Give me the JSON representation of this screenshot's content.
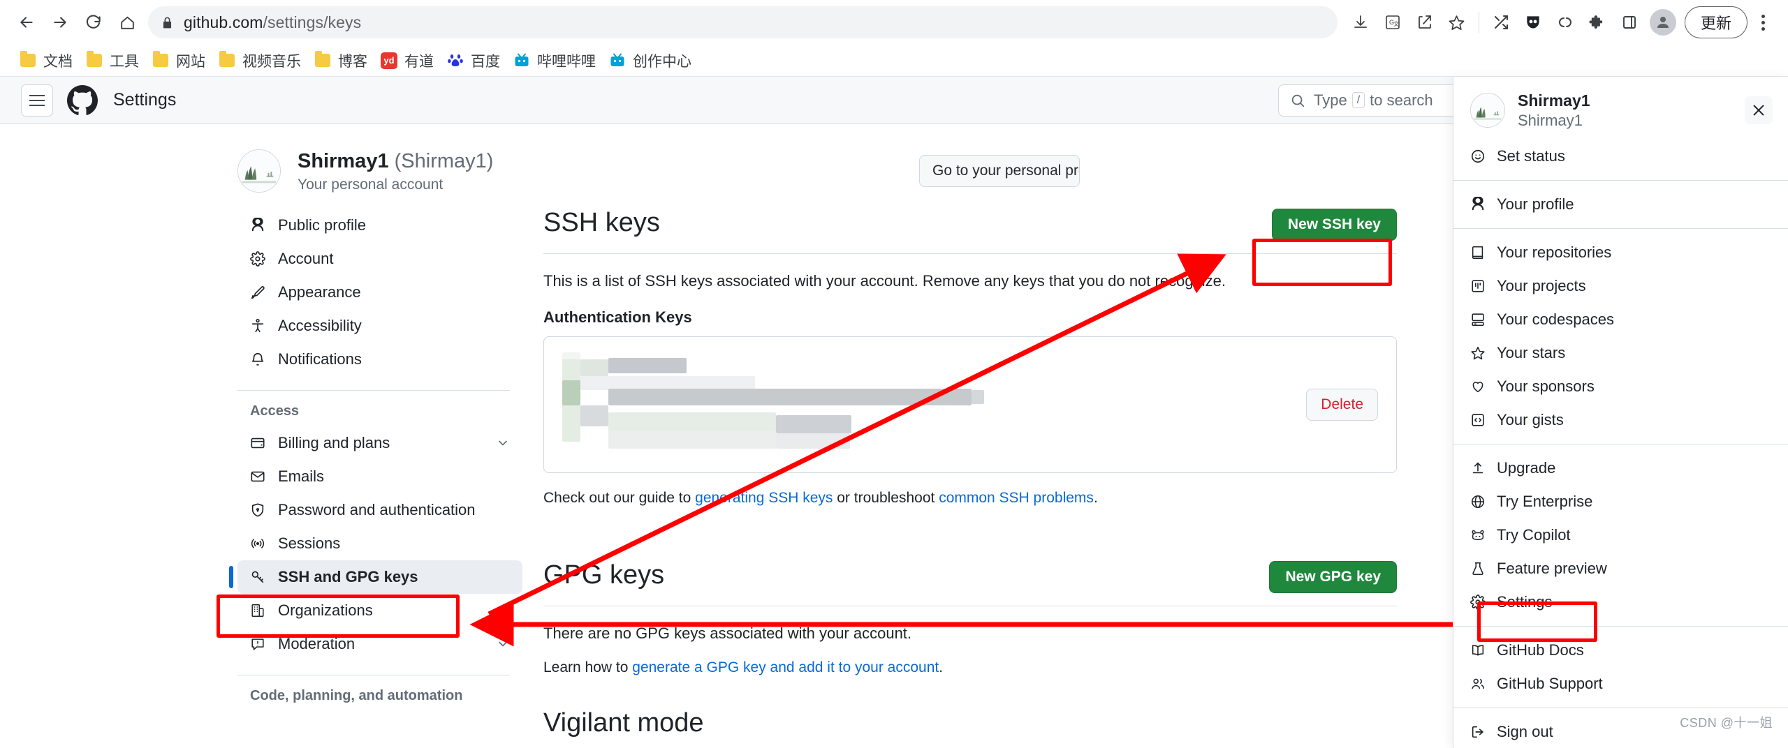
{
  "browser": {
    "url_domain": "github.com",
    "url_path": "/settings/keys",
    "nav": {
      "back": "back-arrow",
      "forward": "forward-arrow",
      "reload": "reload",
      "home": "home"
    },
    "lock_icon": "lock-icon",
    "right_icons": [
      "download-icon",
      "translate-icon",
      "share-icon",
      "star-icon",
      "shuffle-icon",
      "bitwarden-icon",
      "loop-icon",
      "puzzle-icon",
      "side-panel-icon"
    ],
    "update_button": "更新",
    "bookmarks": [
      {
        "label": "文档",
        "icon": "folder-icon",
        "kind": "folder"
      },
      {
        "label": "工具",
        "icon": "folder-icon",
        "kind": "folder"
      },
      {
        "label": "网站",
        "icon": "folder-icon",
        "kind": "folder"
      },
      {
        "label": "视频音乐",
        "icon": "folder-icon",
        "kind": "folder"
      },
      {
        "label": "博客",
        "icon": "folder-icon",
        "kind": "folder"
      },
      {
        "label": "有道",
        "icon": "youdao-icon",
        "kind": "site",
        "glyph": "yd",
        "color": "#e8372f"
      },
      {
        "label": "百度",
        "icon": "baidu-icon",
        "kind": "site",
        "glyph": "du",
        "color": "#2932e1"
      },
      {
        "label": "哔哩哔哩",
        "icon": "bilibili-icon",
        "kind": "site",
        "glyph": "◑",
        "color": "#00a1d6"
      },
      {
        "label": "创作中心",
        "icon": "bilibili-icon",
        "kind": "site",
        "glyph": "◑",
        "color": "#00a1d6"
      }
    ]
  },
  "github_header": {
    "menu_icon": "hamburger-icon",
    "logo": "github-mark-icon",
    "title": "Settings",
    "search": {
      "icon": "search-icon",
      "placeholder_before": "Type",
      "key": "/",
      "placeholder_after": "to search"
    }
  },
  "profile": {
    "avatar": "user-avatar",
    "name": "Shirmay1",
    "handle": "(Shirmay1)",
    "subtitle": "Your personal account",
    "go_to_profile_button": "Go to your personal profile"
  },
  "sidebar": {
    "top_items": [
      {
        "label": "Public profile",
        "icon": "person-icon"
      },
      {
        "label": "Account",
        "icon": "gear-icon"
      },
      {
        "label": "Appearance",
        "icon": "paintbrush-icon"
      },
      {
        "label": "Accessibility",
        "icon": "accessibility-icon"
      },
      {
        "label": "Notifications",
        "icon": "bell-icon"
      }
    ],
    "access_title": "Access",
    "access_items": [
      {
        "label": "Billing and plans",
        "icon": "credit-card-icon",
        "expandable": true
      },
      {
        "label": "Emails",
        "icon": "mail-icon",
        "expandable": false
      },
      {
        "label": "Password and authentication",
        "icon": "shield-lock-icon",
        "expandable": false
      },
      {
        "label": "Sessions",
        "icon": "broadcast-icon",
        "expandable": false
      },
      {
        "label": "SSH and GPG keys",
        "icon": "key-icon",
        "expandable": false,
        "active": true
      },
      {
        "label": "Organizations",
        "icon": "organization-icon",
        "expandable": false
      },
      {
        "label": "Moderation",
        "icon": "report-icon",
        "expandable": true
      }
    ],
    "bottom_group_title": "Code, planning, and automation"
  },
  "main": {
    "ssh": {
      "title": "SSH keys",
      "new_button": "New SSH key",
      "description": "This is a list of SSH keys associated with your account. Remove any keys that you do not recognize.",
      "subheading": "Authentication Keys",
      "key_row_delete": "Delete",
      "key_row_content": "redacted",
      "footnote_prefix": "Check out our guide to ",
      "footnote_link1": "generating SSH keys",
      "footnote_middle": " or troubleshoot ",
      "footnote_link2": "common SSH problems",
      "footnote_suffix": "."
    },
    "gpg": {
      "title": "GPG keys",
      "new_button": "New GPG key",
      "empty_text": "There are no GPG keys associated with your account.",
      "learn_prefix": "Learn how to ",
      "learn_link": "generate a GPG key and add it to your account",
      "learn_suffix": "."
    },
    "next_section_title": "Vigilant mode"
  },
  "user_panel": {
    "avatar": "user-avatar",
    "name": "Shirmay1",
    "handle": "Shirmay1",
    "close_icon": "close-icon",
    "groups": [
      {
        "items": [
          {
            "label": "Set status",
            "icon": "smiley-icon"
          }
        ]
      },
      {
        "items": [
          {
            "label": "Your profile",
            "icon": "person-icon"
          }
        ]
      },
      {
        "items": [
          {
            "label": "Your repositories",
            "icon": "repo-icon"
          },
          {
            "label": "Your projects",
            "icon": "project-icon"
          },
          {
            "label": "Your codespaces",
            "icon": "codespaces-icon"
          },
          {
            "label": "Your stars",
            "icon": "star-icon"
          },
          {
            "label": "Your sponsors",
            "icon": "heart-icon"
          },
          {
            "label": "Your gists",
            "icon": "code-square-icon"
          }
        ]
      },
      {
        "items": [
          {
            "label": "Upgrade",
            "icon": "upload-icon"
          },
          {
            "label": "Try Enterprise",
            "icon": "globe-icon"
          },
          {
            "label": "Try Copilot",
            "icon": "copilot-icon"
          },
          {
            "label": "Feature preview",
            "icon": "beaker-icon"
          },
          {
            "label": "Settings",
            "icon": "gear-icon",
            "highlighted": true
          }
        ]
      },
      {
        "items": [
          {
            "label": "GitHub Docs",
            "icon": "book-icon"
          },
          {
            "label": "GitHub Support",
            "icon": "people-icon"
          }
        ]
      },
      {
        "items": [
          {
            "label": "Sign out",
            "icon": "sign-out-icon"
          }
        ]
      }
    ],
    "watermark": "CSDN @十一姐"
  },
  "annotations": {
    "color": "#fe0000",
    "boxes": [
      "new-ssh-key-button",
      "ssh-and-gpg-keys-sidebar-item",
      "settings-menu-item"
    ],
    "arrows": [
      "arrow-to-new-ssh-key",
      "arrow-to-ssh-gpg-sidebar"
    ]
  }
}
